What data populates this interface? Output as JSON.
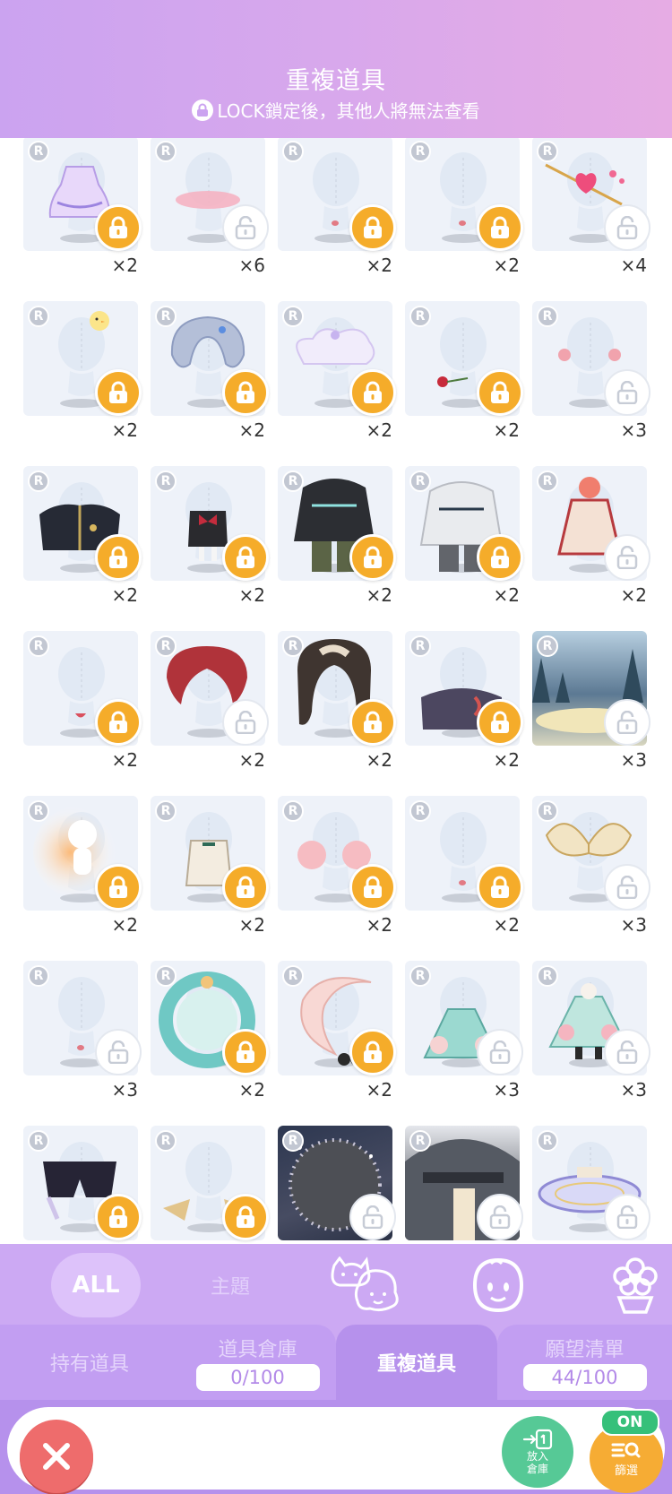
{
  "header": {
    "title": "重複道具",
    "subtitle": "LOCK鎖定後，其他人將無法查看",
    "lock_icon": "lock-icon"
  },
  "items": [
    {
      "rarity": "R",
      "count": "×2",
      "locked": true,
      "art": "purple-dress"
    },
    {
      "rarity": "R",
      "count": "×6",
      "locked": false,
      "art": "pink-blush"
    },
    {
      "rarity": "R",
      "count": "×2",
      "locked": true,
      "art": "mouth"
    },
    {
      "rarity": "R",
      "count": "×2",
      "locked": true,
      "art": "mouth"
    },
    {
      "rarity": "R",
      "count": "×4",
      "locked": false,
      "art": "heart-arrow"
    },
    {
      "rarity": "R",
      "count": "×2",
      "locked": true,
      "art": "chick"
    },
    {
      "rarity": "R",
      "count": "×2",
      "locked": true,
      "art": "silver-hair"
    },
    {
      "rarity": "R",
      "count": "×2",
      "locked": true,
      "art": "cloud-skirt"
    },
    {
      "rarity": "R",
      "count": "×2",
      "locked": true,
      "art": "rose"
    },
    {
      "rarity": "R",
      "count": "×3",
      "locked": false,
      "art": "cheeks"
    },
    {
      "rarity": "R",
      "count": "×2",
      "locked": true,
      "art": "black-coat"
    },
    {
      "rarity": "R",
      "count": "×2",
      "locked": true,
      "art": "bow-outfit"
    },
    {
      "rarity": "R",
      "count": "×2",
      "locked": true,
      "art": "black-hoodie"
    },
    {
      "rarity": "R",
      "count": "×2",
      "locked": true,
      "art": "white-hoodie"
    },
    {
      "rarity": "R",
      "count": "×2",
      "locked": false,
      "art": "red-dress"
    },
    {
      "rarity": "R",
      "count": "×2",
      "locked": true,
      "art": "mouth-open"
    },
    {
      "rarity": "R",
      "count": "×2",
      "locked": false,
      "art": "red-hair"
    },
    {
      "rarity": "R",
      "count": "×2",
      "locked": true,
      "art": "brown-hair"
    },
    {
      "rarity": "R",
      "count": "×2",
      "locked": true,
      "art": "dark-coat"
    },
    {
      "rarity": "R",
      "count": "×3",
      "locked": false,
      "art": "forest-bg"
    },
    {
      "rarity": "R",
      "count": "×2",
      "locked": true,
      "art": "glow"
    },
    {
      "rarity": "R",
      "count": "×2",
      "locked": true,
      "art": "cream-outfit"
    },
    {
      "rarity": "R",
      "count": "×2",
      "locked": true,
      "art": "blush-big"
    },
    {
      "rarity": "R",
      "count": "×2",
      "locked": true,
      "art": "mouth"
    },
    {
      "rarity": "R",
      "count": "×3",
      "locked": false,
      "art": "gold-wings"
    },
    {
      "rarity": "R",
      "count": "×3",
      "locked": false,
      "art": "mouth"
    },
    {
      "rarity": "R",
      "count": "×2",
      "locked": true,
      "art": "teal-ring"
    },
    {
      "rarity": "R",
      "count": "×2",
      "locked": true,
      "art": "moon"
    },
    {
      "rarity": "R",
      "count": "×3",
      "locked": false,
      "art": "teal-dress"
    },
    {
      "rarity": "R",
      "count": "×3",
      "locked": false,
      "art": "teal-dress2"
    },
    {
      "rarity": "R",
      "count": "",
      "locked": true,
      "art": "black-shorts"
    },
    {
      "rarity": "R",
      "count": "",
      "locked": true,
      "art": "gold-ears"
    },
    {
      "rarity": "R",
      "count": "",
      "locked": false,
      "art": "dark-frame"
    },
    {
      "rarity": "R",
      "count": "",
      "locked": false,
      "art": "station-bg"
    },
    {
      "rarity": "R",
      "count": "",
      "locked": false,
      "art": "magic-circle"
    }
  ],
  "filter_tabs": [
    {
      "label": "ALL",
      "active": true
    },
    {
      "label": "主題",
      "active": false
    },
    {
      "icon": "pets-icon"
    },
    {
      "icon": "face-icon"
    },
    {
      "icon": "flower-pot-icon"
    }
  ],
  "sub_tabs": {
    "owned": {
      "label": "持有道具"
    },
    "storage": {
      "label": "道具倉庫",
      "count": "0/100"
    },
    "duplicate": {
      "label": "重複道具",
      "active": true
    },
    "wishlist": {
      "label": "願望清單",
      "count": "44/100"
    }
  },
  "bottom": {
    "close_icon": "close-icon",
    "store_label": "放入倉庫",
    "store_line1": "放入",
    "store_line2": "倉庫",
    "filter_label": "篩選",
    "filter_state": "ON"
  },
  "colors": {
    "header_start": "#cba3f0",
    "header_end": "#e6ace4",
    "lock_gold": "#f5ac2a",
    "close_red": "#ee6c6c",
    "store_green": "#56c996",
    "tab_purple": "#cca9f3"
  }
}
